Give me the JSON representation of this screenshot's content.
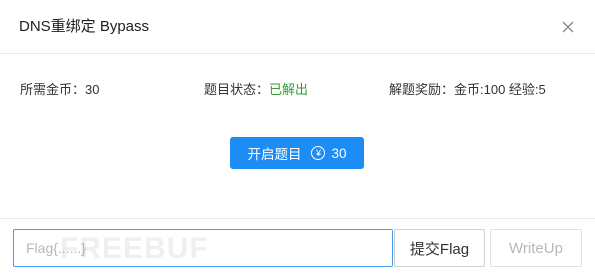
{
  "dialog": {
    "title": "DNS重绑定 Bypass"
  },
  "info": {
    "cost_label": "所需金币：",
    "cost_value": "30",
    "status_label": "题目状态：",
    "status_value": "已解出",
    "reward_label": "解题奖励：",
    "reward_value": "金币:100 经验:5"
  },
  "start_button": {
    "label": "开启题目",
    "coin_symbol": "¥",
    "cost": "30"
  },
  "footer": {
    "flag_placeholder": "Flag{......}",
    "submit_label": "提交Flag",
    "writeup_label": "WriteUp",
    "watermark": "FREEBUF"
  },
  "colors": {
    "primary": "#1e8cf5",
    "solved": "#2f9c36",
    "input_border": "#4a9ef2"
  },
  "icons": {
    "close": "close-icon",
    "coin": "yen-coin-icon"
  }
}
